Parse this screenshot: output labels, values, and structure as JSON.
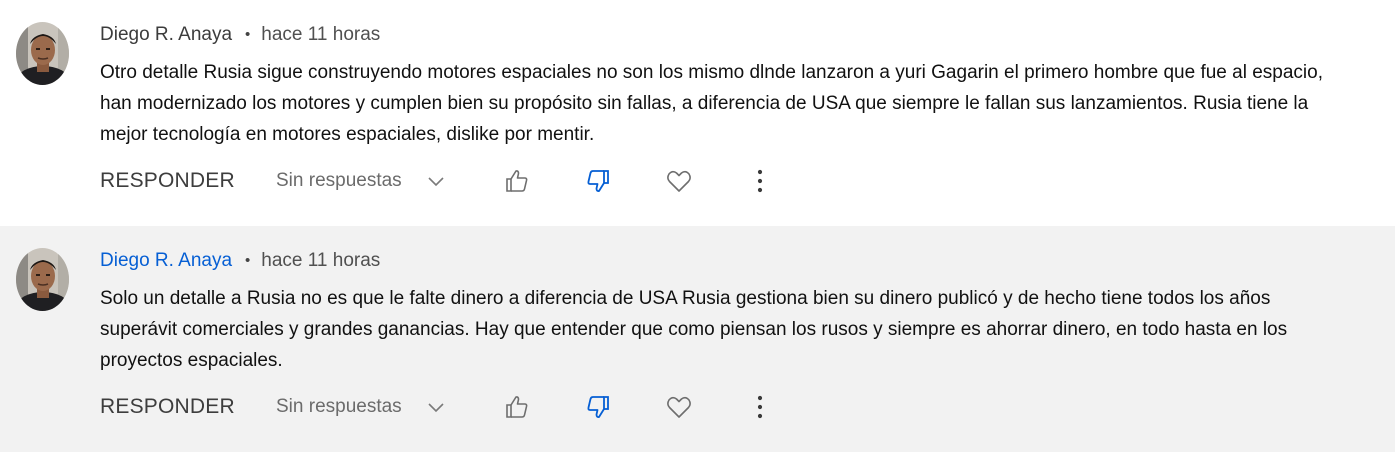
{
  "comments": [
    {
      "author": "Diego R. Anaya",
      "separator": "•",
      "time": "hace 11 horas",
      "text": "Otro detalle Rusia sigue construyendo motores espaciales no son los mismo dlnde lanzaron a yuri Gagarin el primero hombre que fue al espacio, han modernizado los motores y cumplen bien su propósito sin fallas, a diferencia de USA que siempre le fallan sus lanzamientos. Rusia tiene la mejor tecnología en motores espaciales, dislike por mentir.",
      "reply_label": "RESPONDER",
      "replies_label": "Sin respuestas",
      "author_highlighted": false,
      "disliked": true
    },
    {
      "author": "Diego R. Anaya",
      "separator": "•",
      "time": "hace 11 horas",
      "text": "Solo un detalle a Rusia no es que le falte dinero a diferencia de USA Rusia gestiona bien su dinero publicó y de hecho tiene todos los años superávit comerciales y grandes ganancias. Hay que entender que como piensan los rusos y siempre es ahorrar dinero, en todo hasta en los proyectos espaciales.",
      "reply_label": "RESPONDER",
      "replies_label": "Sin respuestas",
      "author_highlighted": true,
      "disliked": true
    }
  ],
  "icons": {
    "like": "thumbs-up-icon",
    "dislike": "thumbs-down-icon",
    "heart": "heart-icon",
    "more": "more-vert-icon",
    "expand": "chevron-down-icon"
  },
  "colors": {
    "link_blue": "#065fd4",
    "selected_bg": "#f2f2f2",
    "icon_gray": "#606060"
  }
}
